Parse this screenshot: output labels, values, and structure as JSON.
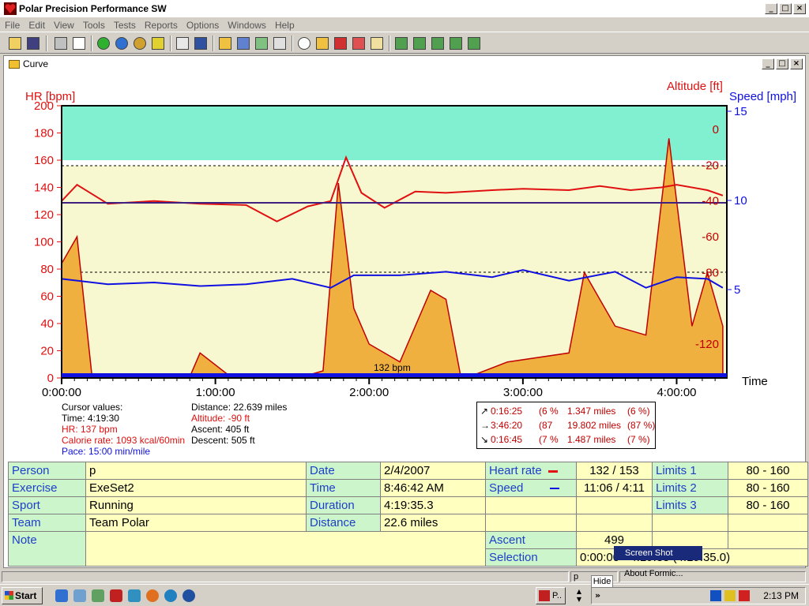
{
  "app": {
    "title": "Polar Precision Performance SW"
  },
  "menu": [
    "File",
    "Edit",
    "View",
    "Tools",
    "Tests",
    "Reports",
    "Options",
    "Windows",
    "Help"
  ],
  "toolbar": {
    "icons": [
      "open-icon",
      "save-icon",
      "print-icon",
      "copy-icon",
      "refresh-icon",
      "globe-icon",
      "compass-icon",
      "signal-icon",
      "calendar-icon",
      "book-icon",
      "chart-area-icon",
      "chart-bar-icon",
      "percent-icon",
      "table-icon",
      "zoom-icon",
      "heart-zone-icon",
      "marker-icon",
      "swap-icon",
      "curve-icon",
      "bar-report-1-icon",
      "bar-report-2-icon",
      "bar-report-3-icon",
      "bar-report-4-icon",
      "bar-report-5-icon"
    ]
  },
  "curve_window": {
    "title": "Curve"
  },
  "chart": {
    "hr_label": "HR [bpm]",
    "alt_label": "Altitude [ft]",
    "speed_label": "Speed [mph]",
    "time_label": "Time",
    "hr_ticks": [
      "200",
      "180",
      "160",
      "140",
      "120",
      "100",
      "80",
      "60",
      "40",
      "20",
      "0"
    ],
    "alt_ticks": [
      "0",
      "-20",
      "-40",
      "-60",
      "-80",
      "-120"
    ],
    "speed_ticks": [
      "15",
      "10",
      "5"
    ],
    "time_ticks": [
      "0:00:00",
      "1:00:00",
      "2:00:00",
      "3:00:00",
      "4:00:00"
    ],
    "avg_label": "132 bpm"
  },
  "chart_data": {
    "type": "line",
    "x_unit": "h:mm:ss",
    "x_range": [
      "0:00:00",
      "4:19:35"
    ],
    "ylim_hr": [
      0,
      200
    ],
    "ylim_speed": [
      0,
      15
    ],
    "grid": false,
    "average_hr": 132,
    "limits_hr": [
      80,
      160
    ],
    "series": [
      {
        "name": "HR [bpm]",
        "color": "#e01010",
        "axis": "left",
        "points": [
          [
            0,
            130
          ],
          [
            0.1,
            142
          ],
          [
            0.3,
            128
          ],
          [
            0.6,
            130
          ],
          [
            0.9,
            128
          ],
          [
            1.2,
            127
          ],
          [
            1.4,
            115
          ],
          [
            1.6,
            126
          ],
          [
            1.75,
            130
          ],
          [
            1.85,
            162
          ],
          [
            1.95,
            136
          ],
          [
            2.1,
            125
          ],
          [
            2.3,
            137
          ],
          [
            2.5,
            136
          ],
          [
            2.8,
            138
          ],
          [
            3.0,
            139
          ],
          [
            3.3,
            138
          ],
          [
            3.5,
            141
          ],
          [
            3.7,
            138
          ],
          [
            3.9,
            140
          ],
          [
            4.0,
            142
          ],
          [
            4.2,
            138
          ],
          [
            4.3,
            134
          ]
        ]
      },
      {
        "name": "Speed [mph]",
        "color": "#1010e0",
        "axis": "right-2",
        "points": [
          [
            0,
            5.6
          ],
          [
            0.3,
            5.3
          ],
          [
            0.6,
            5.4
          ],
          [
            0.9,
            5.2
          ],
          [
            1.2,
            5.3
          ],
          [
            1.5,
            5.6
          ],
          [
            1.75,
            5.1
          ],
          [
            1.9,
            5.8
          ],
          [
            2.2,
            5.8
          ],
          [
            2.5,
            6.0
          ],
          [
            2.8,
            5.7
          ],
          [
            3.0,
            6.1
          ],
          [
            3.3,
            5.5
          ],
          [
            3.6,
            6.0
          ],
          [
            3.8,
            5.1
          ],
          [
            4.0,
            5.7
          ],
          [
            4.2,
            5.6
          ],
          [
            4.3,
            5.1
          ]
        ]
      },
      {
        "name": "Altitude [ft]",
        "color": "#f0b040",
        "axis": "right-1",
        "points": [
          [
            0,
            -75
          ],
          [
            0.1,
            -60
          ],
          [
            0.2,
            -140
          ],
          [
            0.5,
            -140
          ],
          [
            0.8,
            -145
          ],
          [
            0.9,
            -125
          ],
          [
            1.2,
            -145
          ],
          [
            1.5,
            -140
          ],
          [
            1.7,
            -135
          ],
          [
            1.8,
            -30
          ],
          [
            1.9,
            -100
          ],
          [
            2.0,
            -120
          ],
          [
            2.2,
            -130
          ],
          [
            2.4,
            -90
          ],
          [
            2.5,
            -95
          ],
          [
            2.6,
            -140
          ],
          [
            2.9,
            -130
          ],
          [
            3.3,
            -125
          ],
          [
            3.4,
            -80
          ],
          [
            3.6,
            -110
          ],
          [
            3.8,
            -115
          ],
          [
            3.95,
            -5
          ],
          [
            4.1,
            -110
          ],
          [
            4.2,
            -80
          ],
          [
            4.3,
            -110
          ]
        ]
      }
    ]
  },
  "cursor": {
    "header": "Cursor values:",
    "time": "Time: 4:19:30",
    "hr": "HR: 137 bpm",
    "calorie": "Calorie rate: 1093 kcal/60min",
    "pace": "Pace: 15:00 min/mile",
    "distance": "Distance: 22.639 miles",
    "altitude": "Altitude: -90 ft",
    "ascent": "Ascent: 405 ft",
    "descent": "Descent: 505 ft"
  },
  "laps": [
    {
      "time": "0:16:25",
      "pct": "(6 %",
      "dist": "1.347 miles",
      "dpct": "(6 %)"
    },
    {
      "time": "3:46:20",
      "pct": "(87",
      "dist": "19.802 miles",
      "dpct": "(87 %)"
    },
    {
      "time": "0:16:45",
      "pct": "(7 %",
      "dist": "1.487 miles",
      "dpct": "(7 %)"
    }
  ],
  "info": {
    "person_label": "Person",
    "person": "p",
    "exercise_label": "Exercise",
    "exercise": "ExeSet2",
    "sport_label": "Sport",
    "sport": "Running",
    "team_label": "Team",
    "team": "Team Polar",
    "note_label": "Note",
    "note": "",
    "date_label": "Date",
    "date": "2/4/2007",
    "time_label": "Time",
    "time": "8:46:42 AM",
    "duration_label": "Duration",
    "duration": "4:19:35.3",
    "distance_label": "Distance",
    "distance": "22.6 miles",
    "hr_label": "Heart rate",
    "hr": "132 / 153",
    "speed_label": "Speed",
    "speed": "11:06 / 4:11",
    "ascent_label": "Ascent",
    "ascent": "499",
    "selection_label": "Selection",
    "selection": "0:00:00 - 4:19:35 (4:19:35.0)",
    "limits1_label": "Limits 1",
    "limits1": "80 - 160",
    "limits2_label": "Limits 2",
    "limits2": "80 - 160",
    "limits3_label": "Limits 3",
    "limits3": "80 - 160"
  },
  "status": {
    "p": "p",
    "hide": "Hide",
    "screenshot": "Screen Shot",
    "about": "About Formic..."
  },
  "taskbar": {
    "start": "Start",
    "task": "P..",
    "clock": "2:13 PM"
  },
  "colors": {
    "chart_top": "#80f0d0",
    "chart_mid": "#f8f8d0",
    "hr": "#e01010",
    "speed": "#1010e0",
    "altitude_fill": "#f0b040",
    "altitude_line": "#c00000"
  }
}
